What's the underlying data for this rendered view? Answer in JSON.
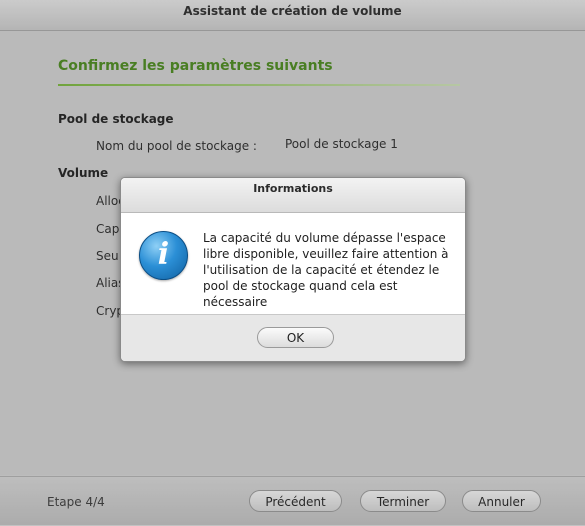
{
  "window": {
    "title": "Assistant de création de volume"
  },
  "content": {
    "section_title": "Confirmez les paramètres suivants",
    "pool_group": {
      "heading": "Pool de stockage",
      "rows": [
        {
          "label": "Nom du pool de stockage :",
          "value": "Pool de stockage 1"
        }
      ]
    },
    "volume_group": {
      "heading": "Volume",
      "rows_visible_prefix": [
        "Alloc",
        "Cap",
        "Seu",
        "Alias",
        "Cryp"
      ]
    }
  },
  "footer": {
    "step": "Etape 4/4",
    "previous_label": "Précédent",
    "finish_label": "Terminer",
    "cancel_label": "Annuler"
  },
  "dialog": {
    "title": "Informations",
    "icon": "info-icon",
    "message": "La capacité du volume dépasse l'espace libre disponible, veuillez faire attention à l'utilisation de la capacité et étendez le pool de stockage quand cela est nécessaire",
    "ok_label": "OK"
  },
  "colors": {
    "accent_green": "#4a8a1c",
    "info_blue": "#2b8fd6"
  }
}
